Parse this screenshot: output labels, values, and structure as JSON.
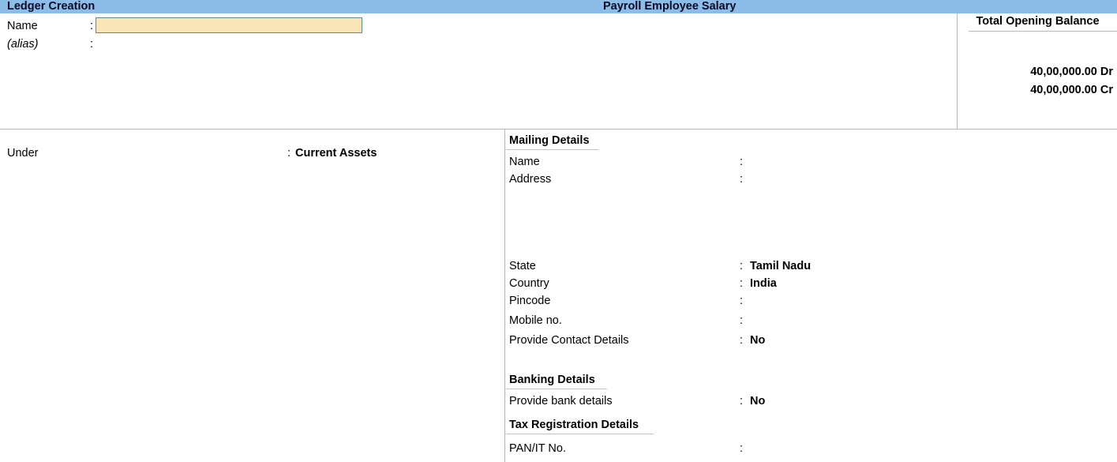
{
  "titlebar": {
    "left_title": "Ledger Creation",
    "center_title": "Payroll Employee Salary",
    "background_color": "#8cbce8",
    "text_color": "#0a0a23"
  },
  "identity": {
    "name_label": "Name",
    "name_colon": ":",
    "name_value": "",
    "name_placeholder": "",
    "alias_label": "(alias)",
    "alias_colon": ":",
    "alias_value": "",
    "input_fill_color": "#fae5b6",
    "input_border_color": "#5f8c8c"
  },
  "opening_balance": {
    "title": "Total Opening Balance",
    "debit": "40,00,000.00 Dr",
    "credit": "40,00,000.00 Cr"
  },
  "grouping": {
    "under_label": "Under",
    "under_colon": ":",
    "under_value": "Current Assets"
  },
  "mailing_details": {
    "heading": "Mailing Details",
    "rows": [
      {
        "label": "Name",
        "colon": ":",
        "value": ""
      },
      {
        "label": "Address",
        "colon": ":",
        "value": ""
      },
      {
        "label": "State",
        "colon": ":",
        "value": "Tamil Nadu"
      },
      {
        "label": "Country",
        "colon": ":",
        "value": "India"
      },
      {
        "label": "Pincode",
        "colon": ":",
        "value": ""
      },
      {
        "label": "Mobile no.",
        "colon": ":",
        "value": ""
      },
      {
        "label": "Provide Contact Details",
        "colon": ":",
        "value": "No"
      }
    ]
  },
  "banking_details": {
    "heading": "Banking Details",
    "rows": [
      {
        "label": "Provide bank details",
        "colon": ":",
        "value": "No"
      }
    ]
  },
  "tax_registration_details": {
    "heading": "Tax Registration Details",
    "rows": [
      {
        "label": "PAN/IT No.",
        "colon": ":",
        "value": ""
      }
    ]
  }
}
